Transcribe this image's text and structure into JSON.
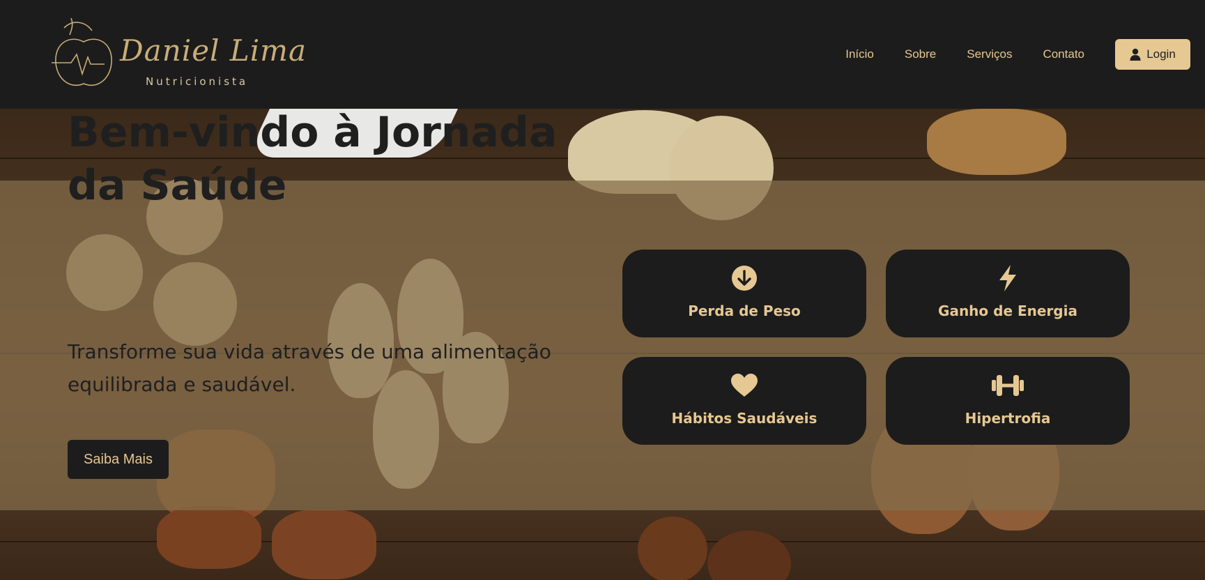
{
  "brand": {
    "name": "Daniel Lima",
    "subtitle": "Nutricionista"
  },
  "nav": {
    "items": [
      "Início",
      "Sobre",
      "Serviços",
      "Contato"
    ],
    "login_label": "Login"
  },
  "hero": {
    "title": "Bem-vindo à Jornada da Saúde",
    "subtitle": "Transforme sua vida através de uma alimentação equilibrada e saudável.",
    "cta_label": "Saiba Mais"
  },
  "services": [
    {
      "label": "Perda de Peso",
      "icon": "arrow-down-circle-icon"
    },
    {
      "label": "Ganho de Energia",
      "icon": "bolt-icon"
    },
    {
      "label": "Hábitos Saudáveis",
      "icon": "heart-icon"
    },
    {
      "label": "Hipertrofia",
      "icon": "dumbbell-icon"
    }
  ],
  "colors": {
    "dark": "#1c1c1c",
    "accent": "#e6c893",
    "overlay": "#856e4b"
  }
}
